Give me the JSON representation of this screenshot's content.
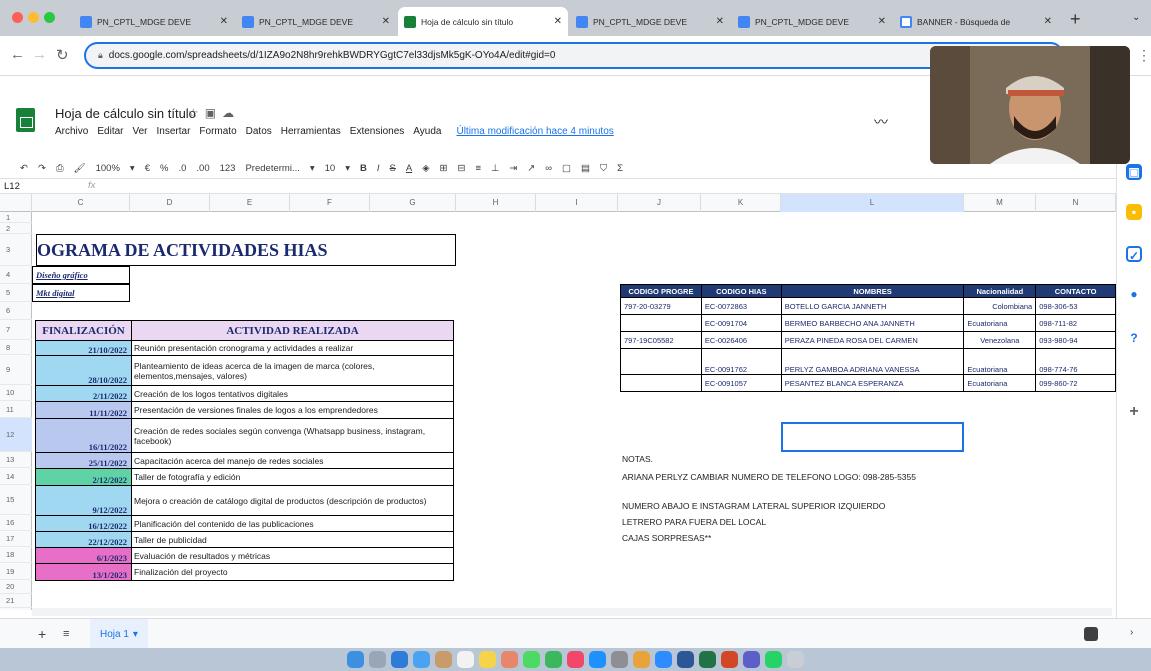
{
  "browser": {
    "tabs": [
      {
        "title": "PN_CPTL_MDGE DEVE",
        "active": false
      },
      {
        "title": "PN_CPTL_MDGE DEVE",
        "active": false
      },
      {
        "title": "Hoja de cálculo sin título",
        "active": true
      },
      {
        "title": "PN_CPTL_MDGE DEVE",
        "active": false
      },
      {
        "title": "PN_CPTL_MDGE DEVE",
        "active": false
      },
      {
        "title": "BANNER - Búsqueda de",
        "active": false
      }
    ],
    "url": "docs.google.com/spreadsheets/d/1IZA9o2N8hr9rehkBWDRYGgtC7el33djsMk5gK-OYo4A/edit#gid=0"
  },
  "sheets": {
    "doc_title": "Hoja de cálculo sin título",
    "menu": [
      "Archivo",
      "Editar",
      "Ver",
      "Insertar",
      "Formato",
      "Datos",
      "Herramientas",
      "Extensiones",
      "Ayuda"
    ],
    "last_edit": "Última modificación hace 4 minutos",
    "toolbar": {
      "zoom": "100%",
      "currency": "€",
      "percent": "%",
      "dec_less": ".0",
      "dec_more": ".00",
      "format_num": "123",
      "font": "Predetermi...",
      "size": "10",
      "bold": "B",
      "italic": "I",
      "strike": "S",
      "text_color": "A",
      "sum": "Σ"
    },
    "cell_ref": "L12",
    "fx": "fx",
    "columns": [
      "C",
      "D",
      "E",
      "F",
      "G",
      "H",
      "I",
      "J",
      "K",
      "L",
      "M",
      "N"
    ],
    "rows": [
      "1",
      "2",
      "3",
      "4",
      "5",
      "6",
      "7",
      "8",
      "9",
      "10",
      "11",
      "12",
      "13",
      "14",
      "15",
      "16",
      "17",
      "18",
      "19",
      "20",
      "21"
    ],
    "banner": "OGRAMA DE ACTIVIDADES HIAS",
    "legend": [
      "Diseño gráfico",
      "Mkt digital"
    ],
    "activities": {
      "header_date": "FINALIZACIÓN",
      "header_activity": "ACTIVIDAD REALIZADA",
      "rows": [
        {
          "date": "21/10/2022",
          "text": "Reunión presentación cronograma y actividades a realizar",
          "color": "#9fd8f0"
        },
        {
          "date": "28/10/2022",
          "text": "Planteamiento de ideas acerca de la imagen de marca (colores, elementos,mensajes, valores)",
          "color": "#9fd8f0"
        },
        {
          "date": "2/11/2022",
          "text": "Creación de los logos tentativos digitales",
          "color": "#9fd8f0"
        },
        {
          "date": "11/11/2022",
          "text": "Presentación de versiones finales de logos a los emprendedores",
          "color": "#b9c8ee"
        },
        {
          "date": "16/11/2022",
          "text": "Creación de redes sociales según convenga (Whatsapp business, instagram, facebook)",
          "color": "#b9c8ee"
        },
        {
          "date": "25/11/2022",
          "text": "Capacitación acerca del manejo de redes sociales",
          "color": "#b9c8ee"
        },
        {
          "date": "2/12/2022",
          "text": "Taller de fotografía y edición",
          "color": "#5fd3a6"
        },
        {
          "date": "9/12/2022",
          "text": "Mejora o creación de catálogo digital de productos (descripción de productos)",
          "color": "#9fd8f0"
        },
        {
          "date": "16/12/2022",
          "text": "Planificación del contenido de las publicaciones",
          "color": "#9fd8f0"
        },
        {
          "date": "22/12/2022",
          "text": "Taller de publicidad",
          "color": "#9fd8f0"
        },
        {
          "date": "6/1/2023",
          "text": "Evaluación de resultados y métricas",
          "color": "#e86fc8"
        },
        {
          "date": "13/1/2023",
          "text": "Finalización del proyecto",
          "color": "#e86fc8"
        }
      ]
    },
    "people": {
      "headers": [
        "CODIGO PROGRE",
        "CODIGO HIAS",
        "NOMBRES",
        "Nacionalidad",
        "CONTACTO"
      ],
      "rows": [
        [
          "797-20-03279",
          "EC-0072863",
          "BOTELLO GARCIA JANNETH",
          "Colombiana",
          "098-306-53"
        ],
        [
          "",
          "EC-0091704",
          "BERMEO BARBECHO ANA JANNETH",
          "Ecuatoriana",
          "098-711-82"
        ],
        [
          "797-19C05582",
          "EC-0026406",
          "PERAZA PINEDA ROSA DEL CARMEN",
          "Venezolana",
          "093-980-94"
        ],
        [
          "",
          "EC-0091762",
          "PERLYZ GAMBOA ADRIANA VANESSA",
          "Ecuatoriana",
          "098-774-76"
        ],
        [
          "",
          "EC-0091057",
          "PESANTEZ BLANCA ESPERANZA",
          "Ecuatoriana",
          "099-860-72"
        ]
      ]
    },
    "notes": [
      "NOTAS.",
      "ARIANA PERLYZ CAMBIAR NUMERO DE TELEFONO LOGO: 098-285-5355",
      "NUMERO ABAJO E INSTAGRAM LATERAL SUPERIOR IZQUIERDO",
      "LETRERO PARA FUERA DEL LOCAL",
      "CAJAS SORPRESAS**"
    ],
    "sheet_tab": "Hoja 1"
  }
}
